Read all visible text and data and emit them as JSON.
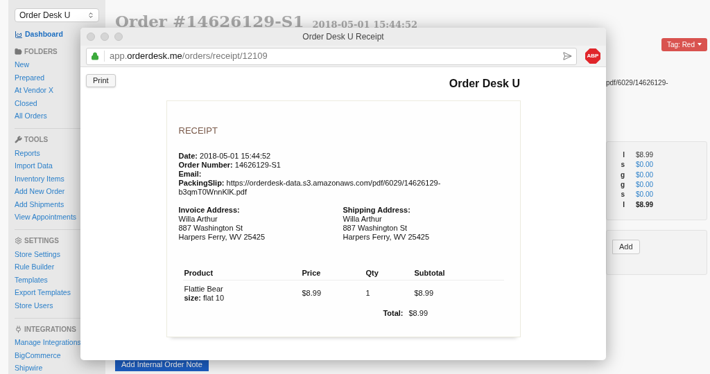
{
  "sidebar": {
    "store_select": "Order Desk U",
    "dashboard": "Dashboard",
    "sections": [
      {
        "kind": "folders",
        "title": "FOLDERS",
        "items": [
          "New",
          "Prepared",
          "At Vendor X",
          "Closed",
          "All Orders"
        ]
      },
      {
        "kind": "tools",
        "title": "TOOLS",
        "items": [
          "Reports",
          "Import Data",
          "Inventory Items",
          "Add New Order",
          "Add Shipments",
          "View Appointments"
        ]
      },
      {
        "kind": "settings",
        "title": "SETTINGS",
        "items": [
          "Store Settings",
          "Rule Builder",
          "Templates",
          "Export Templates",
          "Store Users"
        ]
      },
      {
        "kind": "integrations",
        "title": "INTEGRATIONS",
        "items": [
          "Manage Integrations",
          "BigCommerce",
          "Shipwire"
        ]
      }
    ]
  },
  "page": {
    "title": "Order #14626129-S1",
    "date": "2018-05-01 15:44:52",
    "tag_button": "Tag: Red",
    "slip_fragment": "pdf/6029/14626129-",
    "totals": [
      {
        "label": "l",
        "value": "$8.99",
        "kind": "plain"
      },
      {
        "label": "s",
        "value": "$0.00",
        "kind": "link"
      },
      {
        "label": "g",
        "value": "$0.00",
        "kind": "link"
      },
      {
        "label": "g",
        "value": "$0.00",
        "kind": "link"
      },
      {
        "label": "s",
        "value": "$0.00",
        "kind": "link"
      },
      {
        "label": "l",
        "value": "$8.99",
        "kind": "total"
      }
    ],
    "add_button": "Add",
    "note_button": "Add Internal Order Note"
  },
  "receipt_window": {
    "title": "Order Desk U Receipt",
    "url": {
      "prefix": "app.",
      "domain": "orderdesk.me",
      "path": "/orders/receipt/12109"
    },
    "adblock_badge": "ABP",
    "print_button": "Print",
    "store_name": "Order Desk U",
    "heading": "RECEIPT",
    "details": [
      {
        "label": "Date:",
        "value": "2018-05-01 15:44:52"
      },
      {
        "label": "Order Number:",
        "value": "14626129-S1"
      },
      {
        "label": "Email:"
      },
      {
        "label": "PackingSlip:",
        "value": "https://orderdesk-data.s3.amazonaws.com/pdf/6029/14626129-b3qmT0WnnKlK.pdf"
      }
    ],
    "addresses": [
      {
        "label": "Invoice Address:",
        "lines": [
          "Willa Arthur",
          "887 Washington St",
          "Harpers Ferry, WV 25425"
        ]
      },
      {
        "label": "Shipping Address:",
        "lines": [
          "Willa Arthur",
          "887 Washington St",
          "Harpers Ferry, WV 25425"
        ]
      }
    ],
    "table": {
      "columns": [
        "Product",
        "Price",
        "Qty",
        "Subtotal"
      ],
      "rows": [
        {
          "product": "Flattie Bear",
          "option_label": "size:",
          "option_value": "flat 10",
          "price": "$8.99",
          "qty": "1",
          "subtotal": "$8.99"
        }
      ],
      "total_label": "Total:",
      "total": "$8.99"
    }
  }
}
